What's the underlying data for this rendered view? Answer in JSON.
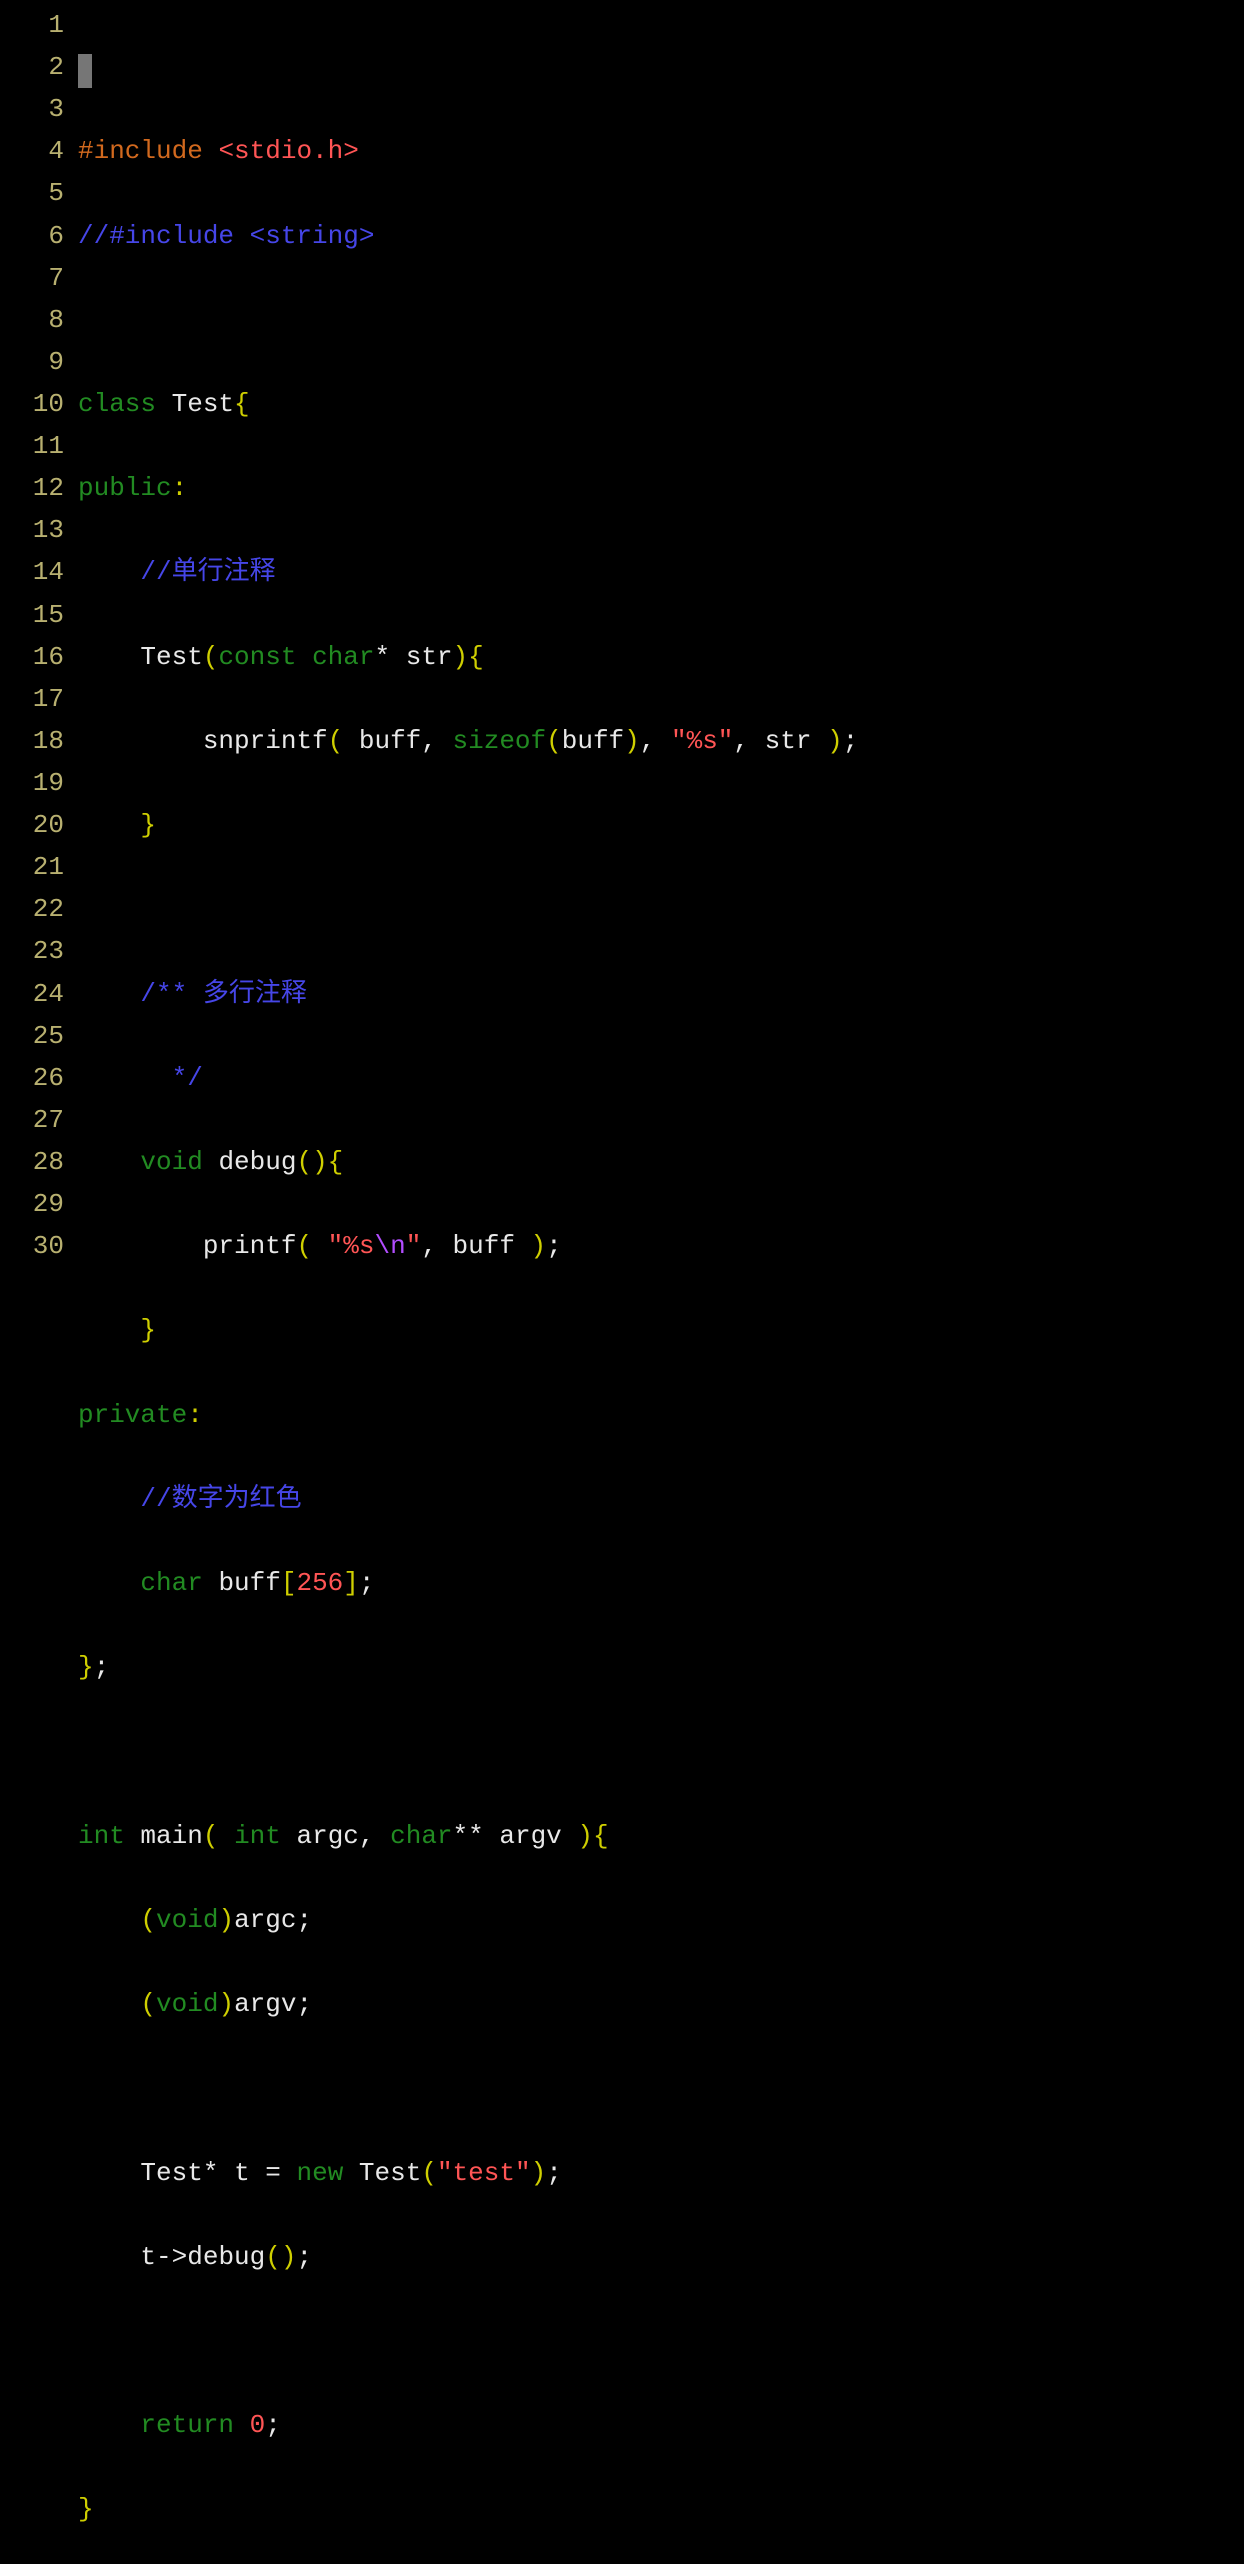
{
  "lineCount": 30,
  "code": {
    "l1": {
      "cursor": true
    },
    "l2": {
      "include": "#include ",
      "header": "<stdio.h>"
    },
    "l3": {
      "comment": "//#include <string>"
    },
    "l5": {
      "kw_class": "class ",
      "name": "Test",
      "brace": "{"
    },
    "l6": {
      "access": "public",
      "colon": ":"
    },
    "l7": {
      "indent": "    ",
      "comment": "//单行注释"
    },
    "l8": {
      "indent": "    ",
      "name": "Test",
      "paren_o": "(",
      "kw_const": "const ",
      "kw_char": "char",
      "star": "* ",
      "param": "str",
      "paren_c": ")",
      "brace": "{"
    },
    "l9": {
      "indent": "        ",
      "fn": "snprintf",
      "paren_o": "( ",
      "a1": "buff",
      "c1": ", ",
      "kw_sizeof": "sizeof",
      "p2o": "(",
      "a2": "buff",
      "p2c": ")",
      "c2": ", ",
      "str": "\"%s\"",
      "c3": ", ",
      "a3": "str ",
      "paren_c": ")",
      "semi": ";"
    },
    "l10": {
      "indent": "    ",
      "brace": "}"
    },
    "l12": {
      "indent": "    ",
      "comment": "/** 多行注释"
    },
    "l13": {
      "indent": "      ",
      "comment": "*/"
    },
    "l14": {
      "indent": "    ",
      "kw_void": "void ",
      "name": "debug",
      "paren_o": "(",
      "paren_c": ")",
      "brace": "{"
    },
    "l15": {
      "indent": "        ",
      "fn": "printf",
      "paren_o": "( ",
      "str1": "\"%s",
      "esc": "\\n",
      "str2": "\"",
      "c1": ", ",
      "a1": "buff ",
      "paren_c": ")",
      "semi": ";"
    },
    "l16": {
      "indent": "    ",
      "brace": "}"
    },
    "l17": {
      "access": "private",
      "colon": ":"
    },
    "l18": {
      "indent": "    ",
      "comment": "//数字为红色"
    },
    "l19": {
      "indent": "    ",
      "kw_char": "char ",
      "name": "buff",
      "brk_o": "[",
      "num": "256",
      "brk_c": "]",
      "semi": ";"
    },
    "l20": {
      "brace": "}",
      "semi": ";"
    },
    "l22": {
      "kw_int": "int ",
      "name": "main",
      "paren_o": "( ",
      "kw_int2": "int ",
      "p1": "argc",
      "c1": ", ",
      "kw_char": "char",
      "stars": "** ",
      "p2": "argv ",
      "paren_c": ")",
      "brace": "{"
    },
    "l23": {
      "indent": "    ",
      "paren_o": "(",
      "kw_void": "void",
      "paren_c": ")",
      "name": "argc",
      "semi": ";"
    },
    "l24": {
      "indent": "    ",
      "paren_o": "(",
      "kw_void": "void",
      "paren_c": ")",
      "name": "argv",
      "semi": ";"
    },
    "l26": {
      "indent": "    ",
      "type": "Test",
      "star": "* ",
      "var": "t ",
      "eq": "= ",
      "kw_new": "new ",
      "ctor": "Test",
      "paren_o": "(",
      "str": "\"test\"",
      "paren_c": ")",
      "semi": ";"
    },
    "l27": {
      "indent": "    ",
      "obj": "t",
      "arrow": "->",
      "fn": "debug",
      "paren_o": "(",
      "paren_c": ")",
      "semi": ";"
    },
    "l29": {
      "indent": "    ",
      "kw_return": "return ",
      "num": "0",
      "semi": ";"
    },
    "l30": {
      "brace": "}"
    }
  }
}
